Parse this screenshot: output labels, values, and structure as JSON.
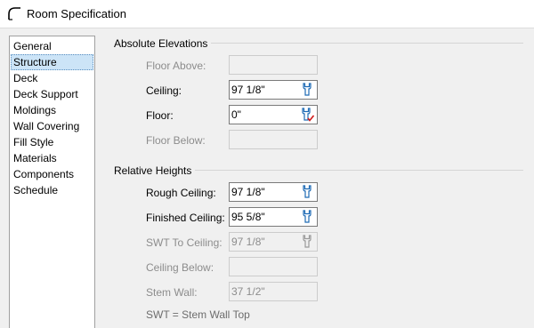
{
  "window": {
    "title": "Room Specification"
  },
  "sidebar": {
    "items": [
      {
        "label": "General",
        "selected": false
      },
      {
        "label": "Structure",
        "selected": true
      },
      {
        "label": "Deck",
        "selected": false
      },
      {
        "label": "Deck Support",
        "selected": false
      },
      {
        "label": "Moldings",
        "selected": false
      },
      {
        "label": "Wall Covering",
        "selected": false
      },
      {
        "label": "Fill Style",
        "selected": false
      },
      {
        "label": "Materials",
        "selected": false
      },
      {
        "label": "Components",
        "selected": false
      },
      {
        "label": "Schedule",
        "selected": false
      }
    ]
  },
  "absolute": {
    "title": "Absolute Elevations",
    "floor_above": {
      "label": "Floor Above:",
      "value": ""
    },
    "ceiling": {
      "label": "Ceiling:",
      "value": "97 1/8\""
    },
    "floor": {
      "label": "Floor:",
      "value": "0\""
    },
    "floor_below": {
      "label": "Floor Below:",
      "value": ""
    }
  },
  "relative": {
    "title": "Relative Heights",
    "rough_ceiling": {
      "label": "Rough Ceiling:",
      "value": "97 1/8\""
    },
    "finished_ceiling": {
      "label": "Finished Ceiling:",
      "value": "95 5/8\""
    },
    "swt_to_ceiling": {
      "label": "SWT To Ceiling:",
      "value": "97 1/8\""
    },
    "ceiling_below": {
      "label": "Ceiling Below:",
      "value": ""
    },
    "stem_wall": {
      "label": "Stem Wall:",
      "value": "37 1/2\""
    }
  },
  "footnote": "SWT = Stem Wall Top",
  "colors": {
    "accent_check": "#d01818",
    "selected_bg": "#cce4f7"
  },
  "icons": {
    "title": "room-arch-icon",
    "field": "wrench-icon",
    "floor_field": "wrench-check-icon"
  }
}
